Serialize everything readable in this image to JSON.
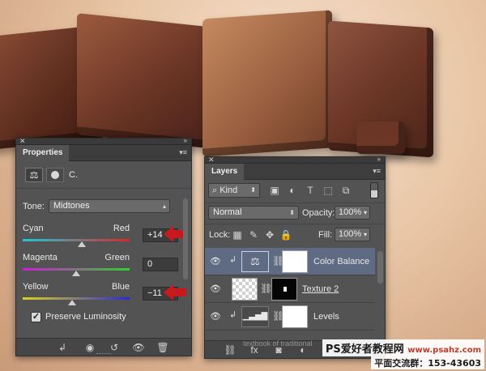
{
  "properties_panel": {
    "tab_title": "Properties",
    "adjustment_icon": "balance-scale-icon",
    "layer_tag": "C.",
    "tone_label": "Tone:",
    "tone_value": "Midtones",
    "sliders": [
      {
        "left": "Cyan",
        "right": "Red",
        "value": "+14",
        "thumb_fraction": 0.55,
        "highlighted": true
      },
      {
        "left": "Magenta",
        "right": "Green",
        "value": "0",
        "thumb_fraction": 0.5,
        "highlighted": false
      },
      {
        "left": "Yellow",
        "right": "Blue",
        "value": "−11",
        "thumb_fraction": 0.46,
        "highlighted": true
      }
    ],
    "preserve_label": "Preserve Luminosity",
    "preserve_checked": true
  },
  "layers_panel": {
    "tab_title": "Layers",
    "filter_kind": "Kind",
    "blend_mode": "Normal",
    "opacity_label": "Opacity:",
    "opacity_value": "100%",
    "lock_label": "Lock:",
    "fill_label": "Fill:",
    "fill_value": "100%",
    "layers": [
      {
        "name": "Color Balance",
        "selected": true
      },
      {
        "name": "Texture 2",
        "selected": false
      },
      {
        "name": "Levels",
        "selected": false
      }
    ],
    "faded_text": "textbook of traditional"
  },
  "watermark": {
    "line1": "PS爱好者教程网",
    "line1_url": "www.psahz.com",
    "line2": "平面交流群：153-43603"
  },
  "colors": {
    "panel_bg": "#535353",
    "selection": "#5e6b82",
    "arrow_red": "#c8191e"
  }
}
